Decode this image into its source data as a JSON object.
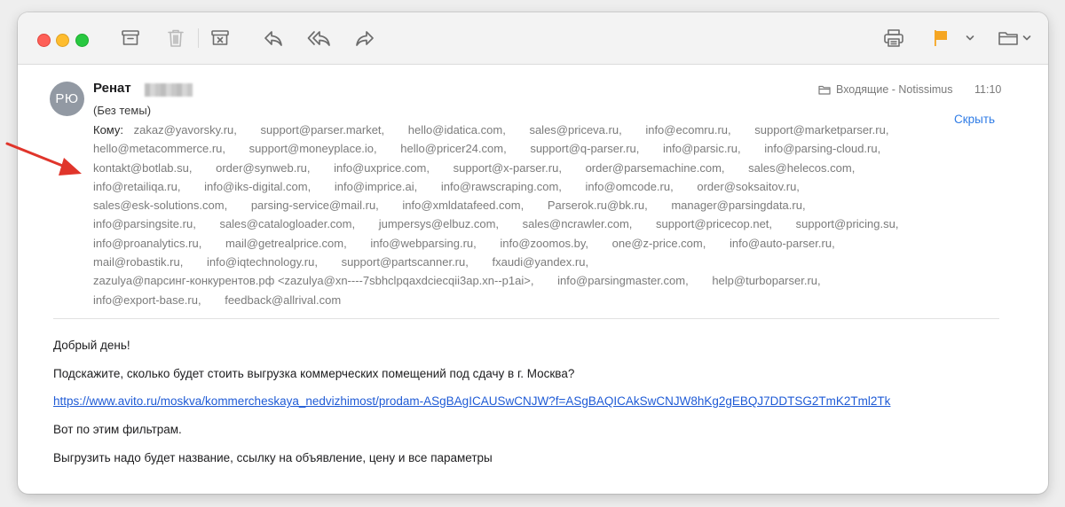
{
  "sender": {
    "initials": "РЮ",
    "name": "Ренат"
  },
  "subject": "(Без темы)",
  "mailbox": "Входящие - Notissimus",
  "time": "11:10",
  "hide_label": "Скрыть",
  "to_label": "Кому:",
  "recipients": [
    "zakaz@yavorsky.ru,",
    "support@parser.market,",
    "hello@idatica.com,",
    "sales@priceva.ru,",
    "info@ecomru.ru,",
    "support@marketparser.ru,",
    "hello@metacommerce.ru,",
    "support@moneyplace.io,",
    "hello@pricer24.com,",
    "support@q-parser.ru,",
    "info@parsic.ru,",
    "info@parsing-cloud.ru,",
    "kontakt@botlab.su,",
    "order@synweb.ru,",
    "info@uxprice.com,",
    "support@x-parser.ru,",
    "order@parsemachine.com,",
    "sales@helecos.com,",
    "info@retailiqa.ru,",
    "info@iks-digital.com,",
    "info@imprice.ai,",
    "info@rawscraping.com,",
    "info@omcode.ru,",
    "order@soksaitov.ru,",
    "sales@esk-solutions.com,",
    "parsing-service@mail.ru,",
    "info@xmldatafeed.com,",
    "Parserok.ru@bk.ru,",
    "manager@parsingdata.ru,",
    "info@parsingsite.ru,",
    "sales@catalogloader.com,",
    "jumpersys@elbuz.com,",
    "sales@ncrawler.com,",
    "support@pricecop.net,",
    "support@pricing.su,",
    "info@proanalytics.ru,",
    "mail@getrealprice.com,",
    "info@webparsing.ru,",
    "info@zoomos.by,",
    "one@z-price.com,",
    "info@auto-parser.ru,",
    "mail@robastik.ru,",
    "info@iqtechnology.ru,",
    "support@partscanner.ru,",
    "fxaudi@yandex.ru,",
    "zazulya@парсинг-конкурентов.рф <zazulya@xn----7sbhclpqaxdciecqii3ap.xn--p1ai>,",
    "info@parsingmaster.com,",
    "help@turboparser.ru,",
    "info@export-base.ru,",
    "feedback@allrival.com"
  ],
  "body": {
    "greeting": "Добрый день!",
    "question": "Подскажите, сколько будет стоить выгрузка коммерческих помещений под сдачу в г. Москва?",
    "link": "https://www.avito.ru/moskva/kommercheskaya_nedvizhimost/prodam-ASgBAgICAUSwCNJW?f=ASgBAQICAkSwCNJW8hKg2gEBQJ7DDTSG2TmK2Tml2Tk",
    "filters": "Вот по этим фильтрам.",
    "request": "Выгрузить надо будет название, ссылку на объявление, цену и все параметры"
  },
  "icons": {
    "archive": "archive-icon",
    "trash": "trash-icon",
    "junk": "junk-icon",
    "reply": "reply-icon",
    "reply_all": "reply-all-icon",
    "forward": "forward-icon",
    "print": "print-icon",
    "flag": "flag-icon",
    "move": "folder-icon"
  },
  "colors": {
    "flag": "#f5a623",
    "link": "#1f5bd6",
    "hide": "#2f7ce6",
    "arrow": "#e0352b"
  }
}
